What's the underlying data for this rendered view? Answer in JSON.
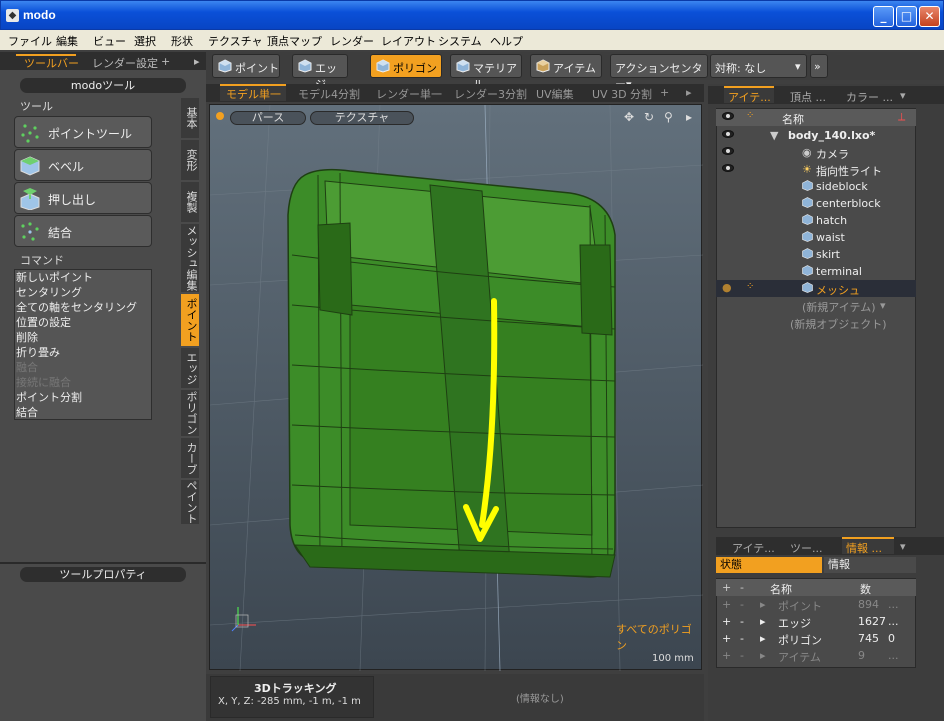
{
  "app": {
    "title": "modo",
    "icon": "modo-app-icon"
  },
  "window_buttons": {
    "minimize": "_",
    "maximize": "□",
    "close": "✕"
  },
  "menu": [
    "ファイル",
    "編集",
    "ビュー",
    "選択",
    "形状",
    "テクスチャ",
    "頂点マップ",
    "レンダー",
    "レイアウト",
    "システム",
    "ヘルプ"
  ],
  "left_tabs": {
    "toolbar": "ツールバー",
    "render_settings": "レンダー設定",
    "add": "+",
    "arrow": "▸"
  },
  "modo_tools": {
    "header": "modoツール",
    "tools_label": "ツール",
    "tools": [
      "ポイントツール",
      "ベベル",
      "押し出し",
      "結合"
    ],
    "commands_label": "コマンド"
  },
  "commands": [
    {
      "label": "新しいポイント",
      "enabled": true
    },
    {
      "label": "センタリング",
      "enabled": true
    },
    {
      "label": "全ての軸をセンタリング",
      "enabled": true
    },
    {
      "label": "位置の設定",
      "enabled": true
    },
    {
      "label": "削除",
      "enabled": true
    },
    {
      "label": "折り畳み",
      "enabled": true
    },
    {
      "label": "融合",
      "enabled": false
    },
    {
      "label": "接続に融合",
      "enabled": false
    },
    {
      "label": "ポイント分割",
      "enabled": true
    },
    {
      "label": "結合",
      "enabled": true
    }
  ],
  "side_tabs": [
    "基本",
    "変形",
    "複製",
    "メッシュ編集",
    "ポイント",
    "エッジ",
    "ポリゴン",
    "カーブ",
    "ペイント"
  ],
  "side_tab_active": "ポイント",
  "tool_properties": "ツールプロパティ",
  "toolbar": {
    "point": "ポイント",
    "edge": "エッジ",
    "polygon": "ポリゴン",
    "material": "マテリアル",
    "item": "アイテム",
    "action_center": "アクションセンター▾",
    "symmetry": "対称: なし",
    "dropdown": "▾",
    "more": "»"
  },
  "viewport_tabs": [
    "モデル単一",
    "モデル4分割",
    "レンダー単一",
    "レンダー3分割",
    "UV編集",
    "UV 3D 分割",
    "+"
  ],
  "viewport_arrow": "▸",
  "viewport": {
    "view_mode": "パース",
    "shading": "テクスチャ",
    "info": "すべてのポリゴン",
    "scale": "100 mm",
    "nav_icons": [
      "✥",
      "↻",
      "⚲",
      "▸"
    ]
  },
  "status": {
    "title": "3Dトラッキング",
    "coords": "X, Y, Z:   -285 mm, -1 m, -1 m",
    "info": "(情報なし)"
  },
  "right_tabs": {
    "items": "アイテ...",
    "vertex": "頂点 ...",
    "color": "カラー ...",
    "menu": "▾"
  },
  "item_list": {
    "header": "名称",
    "scene": "body_140.lxo*",
    "children": [
      "カメラ",
      "指向性ライト",
      "sideblock",
      "centerblock",
      "hatch",
      "waist",
      "skirt",
      "terminal",
      "メッシュ"
    ],
    "new_item": "(新規アイテム)",
    "new_object": "(新規オブジェクト)"
  },
  "info_tabs": {
    "items": "アイテ...",
    "tools": "ツー...",
    "info": "情報 ...",
    "menu": "▾"
  },
  "info_panel": {
    "state_label": "状態",
    "info_label": "情報",
    "col_name": "名称",
    "col_count": "数",
    "rows": [
      {
        "name": "ポイント",
        "count": "894",
        "sel": "...",
        "active": false
      },
      {
        "name": "エッジ",
        "count": "1627",
        "sel": "...",
        "active": true
      },
      {
        "name": "ポリゴン",
        "count": "745",
        "sel": "0",
        "active": true
      },
      {
        "name": "アイテム",
        "count": "9",
        "sel": "...",
        "active": false
      }
    ]
  },
  "colors": {
    "accent": "#f2a020",
    "mesh_green": "#3c8c28",
    "annotation_arrow": "#ffff00"
  }
}
